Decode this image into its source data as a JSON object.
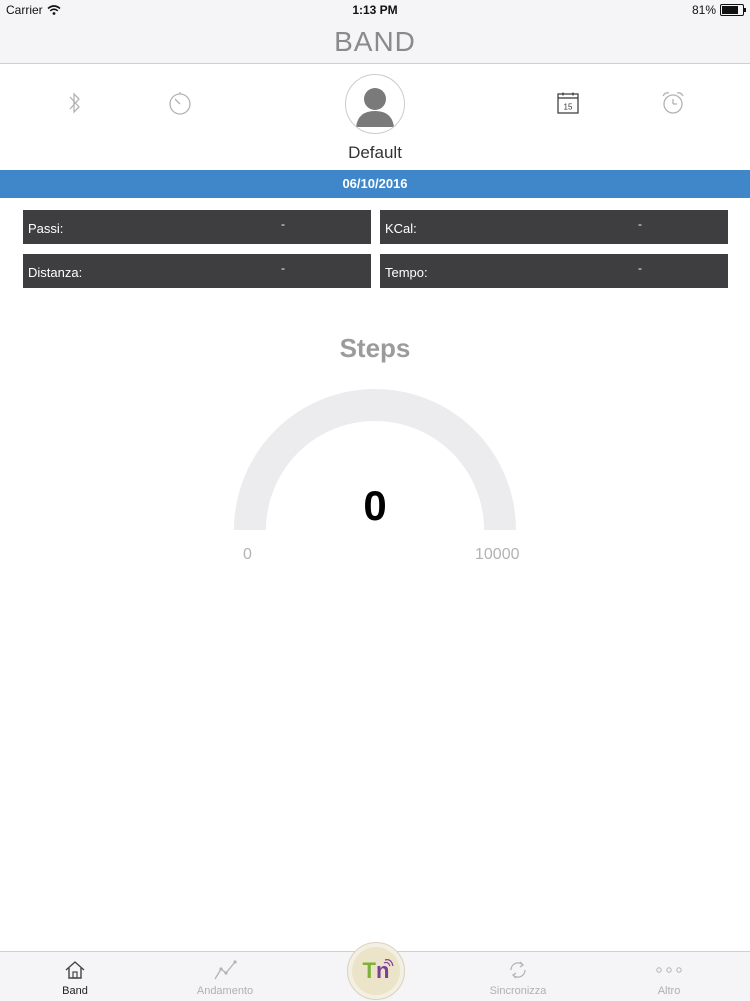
{
  "status_bar": {
    "carrier": "Carrier",
    "time": "1:13 PM",
    "battery_percent": "81%",
    "battery_level": 0.81
  },
  "nav": {
    "title": "BAND"
  },
  "toolbar": {
    "icons": [
      "bluetooth-icon",
      "timer-icon",
      "calendar-icon",
      "alarm-clock-icon"
    ],
    "calendar_day": "15"
  },
  "profile": {
    "name": "Default"
  },
  "date_bar": {
    "date": "06/10/2016"
  },
  "stats": [
    {
      "label": "Passi:",
      "value": "-"
    },
    {
      "label": "KCal:",
      "value": "-"
    },
    {
      "label": "Distanza:",
      "value": "-"
    },
    {
      "label": "Tempo:",
      "value": "-"
    }
  ],
  "gauge": {
    "title": "Steps",
    "value": "0",
    "value_number": 0,
    "min": "0",
    "max": "10000",
    "max_number": 10000
  },
  "tabbar": {
    "tabs": [
      {
        "label": "Band",
        "icon": "home-icon",
        "active": true
      },
      {
        "label": "Andamento",
        "icon": "chart-line-icon",
        "active": false
      },
      {
        "label": "Sincronizza",
        "icon": "sync-icon",
        "active": false
      },
      {
        "label": "Altro",
        "icon": "more-dots-icon",
        "active": false
      }
    ],
    "center_badge_t": "T",
    "center_badge_n": "n"
  },
  "colors": {
    "accent": "#3f87c8",
    "stat_bg": "#3e3e40",
    "gauge_track": "#ececee",
    "badge_t": "#7cb23a",
    "badge_n": "#7b3f98"
  }
}
